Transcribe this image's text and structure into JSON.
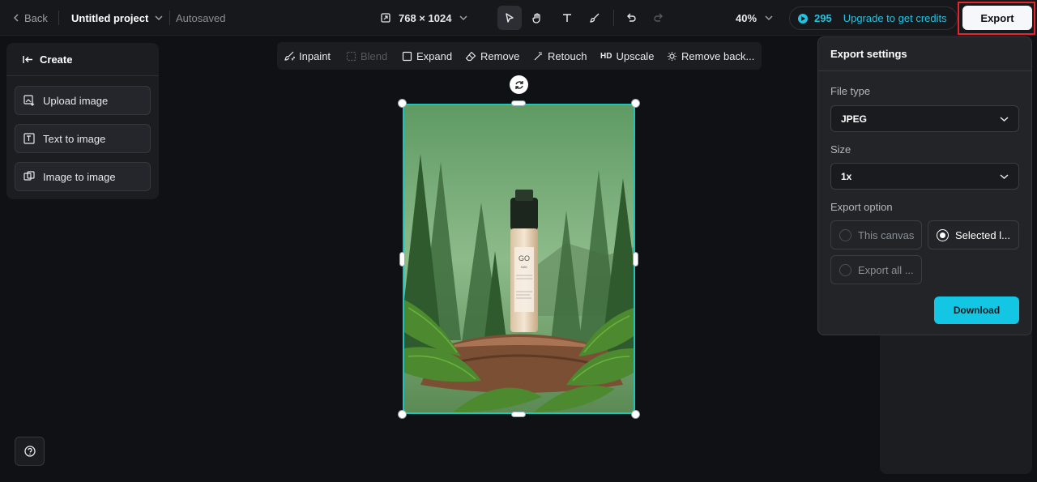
{
  "topbar": {
    "back_label": "Back",
    "project_title": "Untitled project",
    "autosave_status": "Autosaved",
    "canvas_size": "768 × 1024",
    "zoom": "40%",
    "credits": "295",
    "upgrade_label": "Upgrade to get credits",
    "export_label": "Export"
  },
  "left_panel": {
    "title": "Create",
    "items": [
      {
        "label": "Upload image",
        "icon": "upload-image-icon"
      },
      {
        "label": "Text to image",
        "icon": "text-to-image-icon"
      },
      {
        "label": "Image to image",
        "icon": "image-to-image-icon"
      }
    ]
  },
  "context_toolbar": {
    "items": [
      {
        "label": "Inpaint",
        "icon": "inpaint-icon",
        "enabled": true
      },
      {
        "label": "Blend",
        "icon": "blend-icon",
        "enabled": false
      },
      {
        "label": "Expand",
        "icon": "expand-icon",
        "enabled": true
      },
      {
        "label": "Remove",
        "icon": "eraser-icon",
        "enabled": true
      },
      {
        "label": "Retouch",
        "icon": "magic-wand-icon",
        "enabled": true
      },
      {
        "label": "Upscale",
        "icon": "hd-icon",
        "badge": "HD",
        "enabled": true
      },
      {
        "label": "Remove back...",
        "icon": "remove-background-icon",
        "enabled": true
      }
    ]
  },
  "canvas": {
    "product_brand": "GO",
    "product_sub": "NAK"
  },
  "export_settings": {
    "title": "Export settings",
    "file_type_label": "File type",
    "file_type_value": "JPEG",
    "size_label": "Size",
    "size_value": "1x",
    "export_option_label": "Export option",
    "options": [
      {
        "label": "This canvas",
        "selected": false
      },
      {
        "label": "Selected l...",
        "selected": true
      },
      {
        "label": "Export all ...",
        "selected": false
      }
    ],
    "download_label": "Download"
  },
  "colors": {
    "accent": "#13c6e3",
    "selection": "#1fc4b8",
    "highlight": "#e5262c"
  }
}
